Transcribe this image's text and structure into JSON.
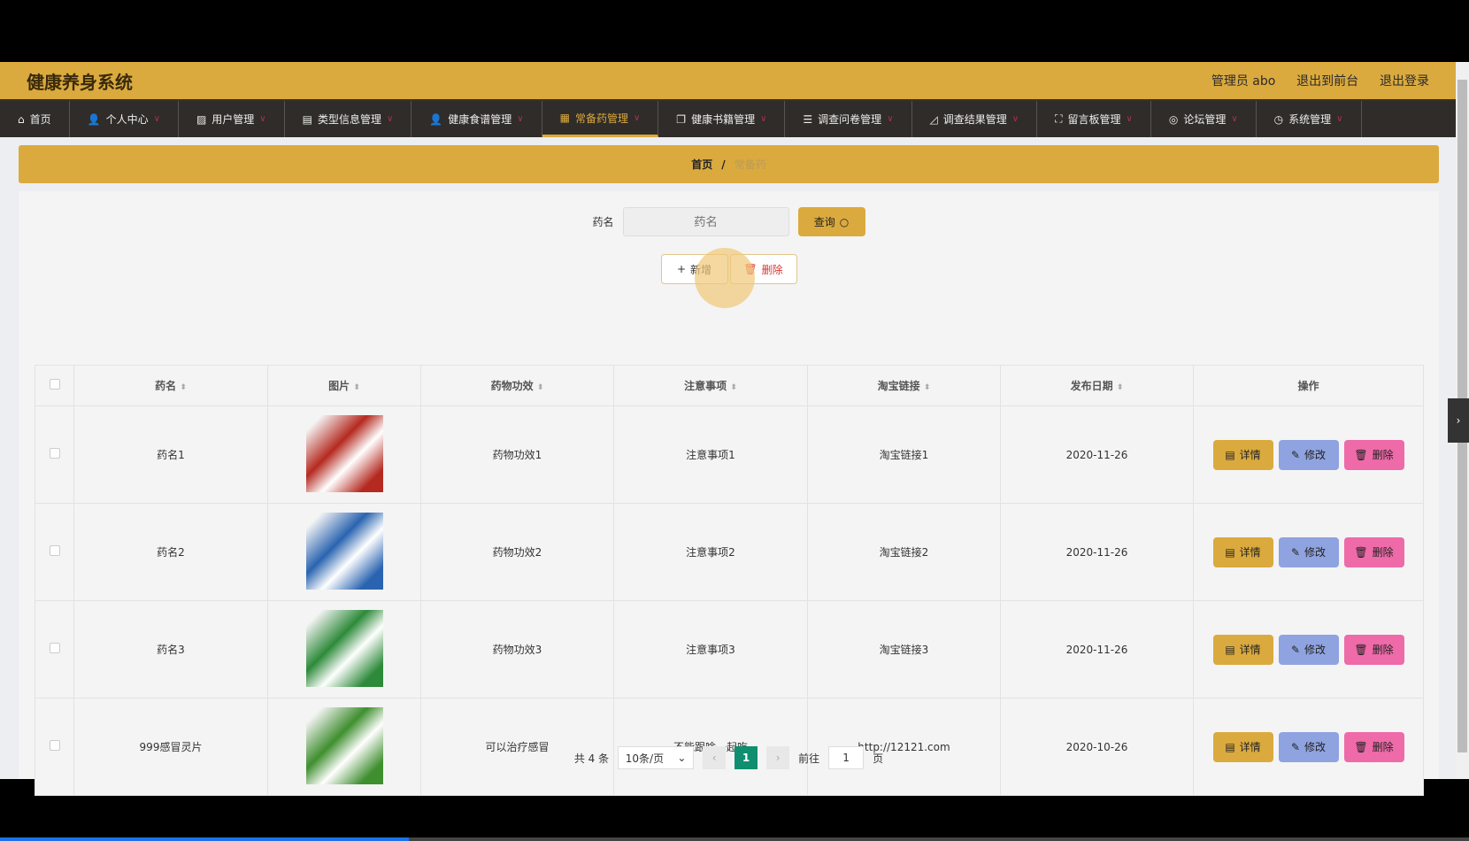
{
  "header": {
    "title": "健康养身系统",
    "user": "管理员 abo",
    "to_front": "退出到前台",
    "logout": "退出登录"
  },
  "nav": [
    {
      "label": "首页",
      "icon": "home"
    },
    {
      "label": "个人中心",
      "icon": "user"
    },
    {
      "label": "用户管理",
      "icon": "chart"
    },
    {
      "label": "类型信息管理",
      "icon": "card"
    },
    {
      "label": "健康食谱管理",
      "icon": "user"
    },
    {
      "label": "常备药管理",
      "icon": "grid",
      "active": true
    },
    {
      "label": "健康书籍管理",
      "icon": "copy"
    },
    {
      "label": "调查问卷管理",
      "icon": "list"
    },
    {
      "label": "调查结果管理",
      "icon": "bell"
    },
    {
      "label": "留言板管理",
      "icon": "frame"
    },
    {
      "label": "论坛管理",
      "icon": "circle"
    },
    {
      "label": "系统管理",
      "icon": "clock"
    }
  ],
  "breadcrumb": {
    "home": "首页",
    "sep": "/",
    "current": "常备药"
  },
  "search": {
    "label": "药名",
    "placeholder": "药名",
    "query": "查询"
  },
  "actions": {
    "add": "新增",
    "delete": "删除"
  },
  "table": {
    "headers": [
      "药名",
      "图片",
      "药物功效",
      "注意事项",
      "淘宝链接",
      "发布日期",
      "操作"
    ],
    "rows": [
      {
        "name": "药名1",
        "effect": "药物功效1",
        "note": "注意事项1",
        "link": "淘宝链接1",
        "date": "2020-11-26",
        "img": "#b52a20"
      },
      {
        "name": "药名2",
        "effect": "药物功效2",
        "note": "注意事项2",
        "link": "淘宝链接2",
        "date": "2020-11-26",
        "img": "#2a64b0"
      },
      {
        "name": "药名3",
        "effect": "药物功效3",
        "note": "注意事项3",
        "link": "淘宝链接3",
        "date": "2020-11-26",
        "img": "#2d8a3a"
      },
      {
        "name": "999感冒灵片",
        "effect": "可以治疗感冒",
        "note": "不能跟啥一起吃",
        "link": "http://12121.com",
        "date": "2020-10-26",
        "img": "#3f8f2f"
      }
    ],
    "ops": {
      "detail": "详情",
      "edit": "修改",
      "delete": "删除"
    }
  },
  "pager": {
    "total": "共 4 条",
    "size": "10条/页",
    "page": "1",
    "goto": "前往",
    "goto_value": "1",
    "page_unit": "页"
  }
}
